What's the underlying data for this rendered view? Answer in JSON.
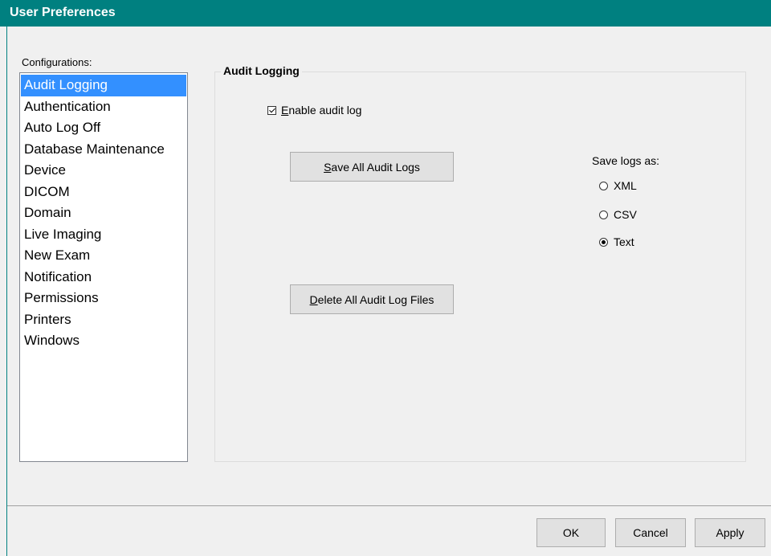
{
  "window": {
    "title": "User Preferences"
  },
  "sidebar": {
    "label": "Configurations:",
    "items": [
      {
        "label": "Audit Logging",
        "selected": true
      },
      {
        "label": "Authentication"
      },
      {
        "label": "Auto Log Off"
      },
      {
        "label": "Database Maintenance"
      },
      {
        "label": "Device"
      },
      {
        "label": "DICOM"
      },
      {
        "label": "Domain"
      },
      {
        "label": "Live Imaging"
      },
      {
        "label": "New Exam"
      },
      {
        "label": "Notification"
      },
      {
        "label": "Permissions"
      },
      {
        "label": "Printers"
      },
      {
        "label": "Windows"
      }
    ]
  },
  "audit": {
    "group_title": "Audit Logging",
    "enable_checkbox": {
      "label_mnemonic": "E",
      "label_rest": "nable audit log",
      "checked": true
    },
    "save_button": {
      "mnemonic": "S",
      "rest": "ave All Audit Logs"
    },
    "delete_button": {
      "mnemonic": "D",
      "rest": "elete All Audit Log Files"
    },
    "save_as": {
      "label": "Save logs as:",
      "options": [
        {
          "label": "XML",
          "checked": false
        },
        {
          "label": "CSV",
          "checked": false
        },
        {
          "label": "Text",
          "checked": true
        }
      ]
    }
  },
  "footer": {
    "ok": "OK",
    "cancel": "Cancel",
    "apply": "Apply"
  },
  "colors": {
    "title_bar": "#008080",
    "selection": "#3390ff",
    "background": "#f0f0f0"
  }
}
